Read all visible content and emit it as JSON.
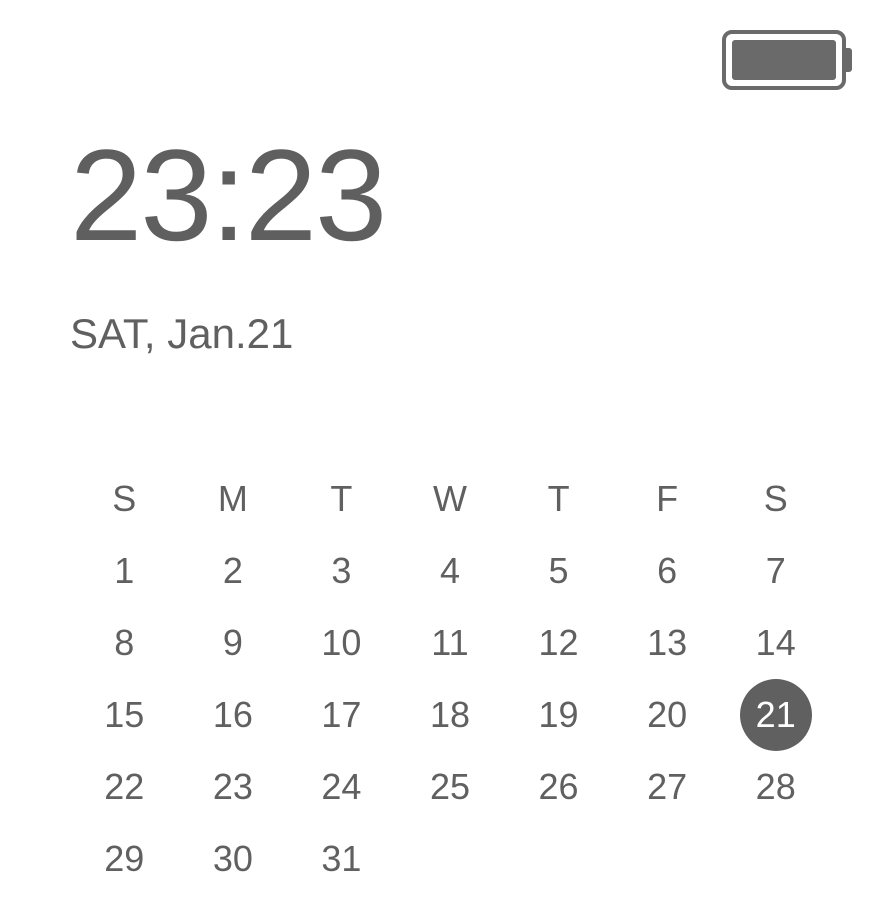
{
  "status": {
    "battery_level": "full"
  },
  "clock": {
    "time": "23:23",
    "date": "SAT, Jan.21"
  },
  "calendar": {
    "weekdays": [
      "S",
      "M",
      "T",
      "W",
      "T",
      "F",
      "S"
    ],
    "today": 21,
    "weeks": [
      [
        1,
        2,
        3,
        4,
        5,
        6,
        7
      ],
      [
        8,
        9,
        10,
        11,
        12,
        13,
        14
      ],
      [
        15,
        16,
        17,
        18,
        19,
        20,
        21
      ],
      [
        22,
        23,
        24,
        25,
        26,
        27,
        28
      ],
      [
        29,
        30,
        31,
        null,
        null,
        null,
        null
      ]
    ]
  }
}
